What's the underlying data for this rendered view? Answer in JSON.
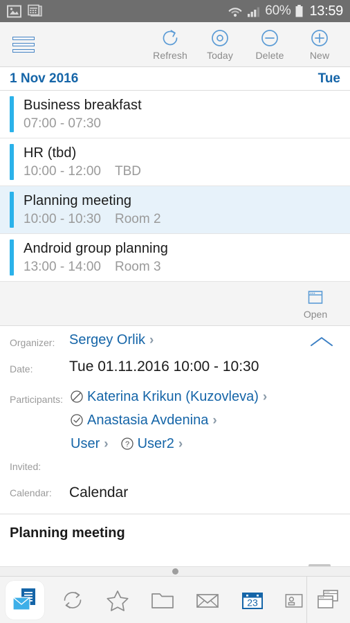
{
  "status_bar": {
    "left_icons": [
      "image-icon",
      "calendar-notification-icon"
    ],
    "wifi_icon": "wifi-icon",
    "signal_icon": "cell-signal-icon",
    "battery_percent": "60%",
    "battery_icon": "battery-icon",
    "clock": "13:59",
    "bg_color": "#6e6e6e"
  },
  "toolbar": {
    "menu_icon": "hamburger-menu-icon",
    "actions": [
      {
        "label": "Refresh",
        "icon": "refresh-icon"
      },
      {
        "label": "Today",
        "icon": "today-target-icon"
      },
      {
        "label": "Delete",
        "icon": "delete-minus-icon"
      },
      {
        "label": "New",
        "icon": "new-plus-icon"
      }
    ],
    "accent_color": "#4a87c4"
  },
  "date_header": {
    "date": "1 Nov 2016",
    "weekday": "Tue",
    "color": "#1565a8"
  },
  "events": [
    {
      "title": "Business breakfast",
      "time": "07:00 - 07:30",
      "location": "",
      "selected": false,
      "bar_color": "#2bb2ea"
    },
    {
      "title": "HR (tbd)",
      "time": "10:00 - 12:00",
      "location": "TBD",
      "selected": false,
      "bar_color": "#2bb2ea"
    },
    {
      "title": "Planning meeting",
      "time": "10:00 - 10:30",
      "location": "Room 2",
      "selected": true,
      "bar_color": "#2bb2ea"
    },
    {
      "title": "Android group planning",
      "time": "13:00 - 14:00",
      "location": "Room 3",
      "selected": false,
      "bar_color": "#2bb2ea"
    }
  ],
  "open_strip": {
    "label": "Open",
    "icon": "open-window-icon"
  },
  "details": {
    "organizer_label": "Organizer:",
    "organizer_name": "Sergey Orlik",
    "date_label": "Date:",
    "date_value": "Tue 01.11.2016 10:00 - 10:30",
    "participants_label": "Participants:",
    "participants": [
      {
        "name": "Katerina Krikun (Kuzovleva)",
        "status_icon": "declined-circle-slash-icon"
      },
      {
        "name": "Anastasia Avdenina",
        "status_icon": "accepted-check-circle-icon"
      },
      {
        "name": "User",
        "status_icon": "none"
      },
      {
        "name": "User2",
        "status_icon": "tentative-question-circle-icon"
      }
    ],
    "invited_label": "Invited:",
    "invited_value": "",
    "calendar_label": "Calendar:",
    "calendar_value": "Calendar",
    "collapse_icon": "chevron-up-icon",
    "link_color": "#1565a8"
  },
  "subject": {
    "title": "Planning meeting"
  },
  "bottom_nav": {
    "drag_handle_icon": "drag-handle-dot",
    "items": [
      {
        "name": "app-icon",
        "icon": "mail-document-app-icon",
        "active": false
      },
      {
        "name": "sync",
        "icon": "sync-arrows-icon",
        "active": false
      },
      {
        "name": "favorites",
        "icon": "star-icon",
        "active": false
      },
      {
        "name": "folders",
        "icon": "folder-icon",
        "active": false
      },
      {
        "name": "mail",
        "icon": "envelope-icon",
        "active": false
      },
      {
        "name": "calendar",
        "icon": "calendar-23-icon",
        "active": true,
        "day_number": "23"
      },
      {
        "name": "contacts",
        "icon": "contact-card-icon",
        "active": false
      },
      {
        "name": "windows",
        "icon": "windows-stack-icon",
        "active": false
      }
    ],
    "active_color": "#1565a8"
  }
}
